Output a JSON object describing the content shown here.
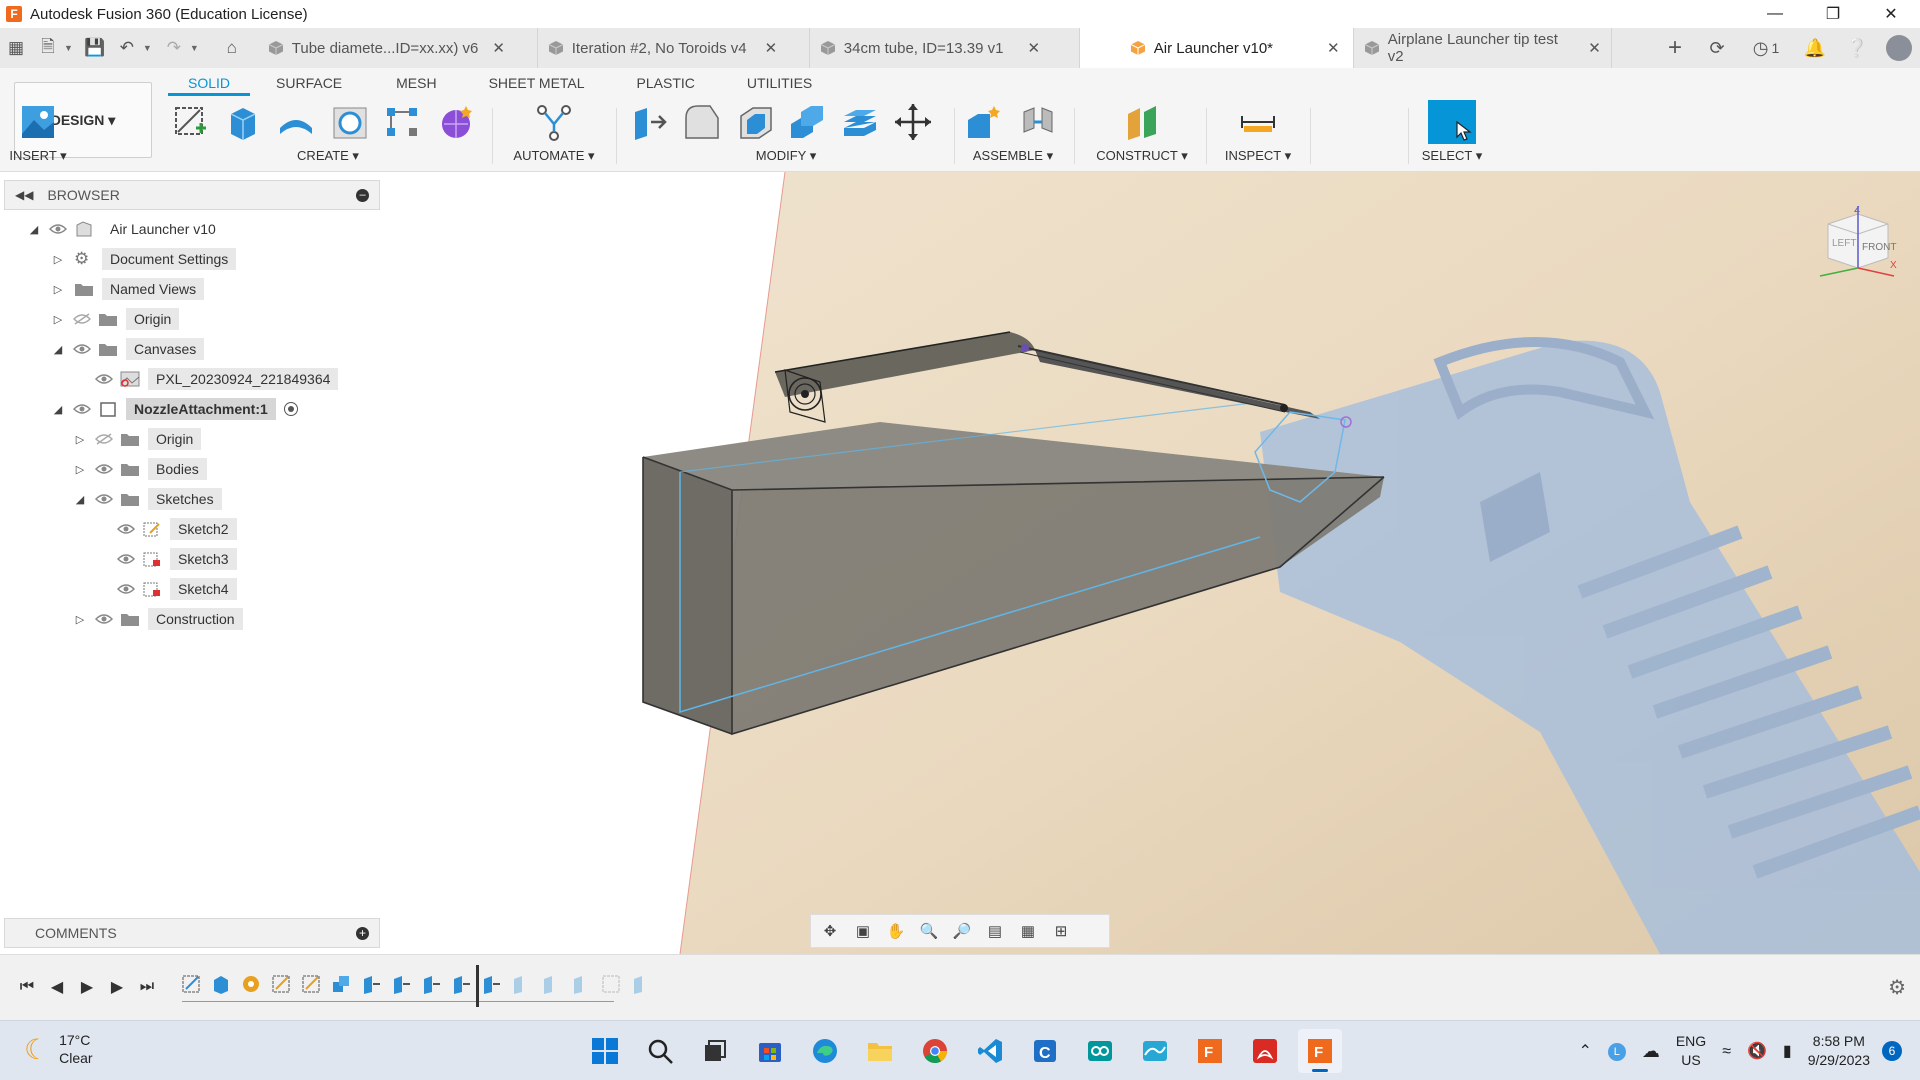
{
  "window": {
    "title": "Autodesk Fusion 360 (Education License)",
    "logo_letter": "F"
  },
  "tabs": [
    {
      "label": "Tube diamete...ID=xx.xx) v6",
      "active": false
    },
    {
      "label": "Iteration #2, No Toroids v4",
      "active": false
    },
    {
      "label": "34cm tube, ID=13.39 v1",
      "active": false
    },
    {
      "label": "Air Launcher v10*",
      "active": true
    },
    {
      "label": "Airplane Launcher tip test v2",
      "active": false
    }
  ],
  "tab_right": {
    "job_count": "1"
  },
  "ribbon": {
    "design_label": "DESIGN ▾",
    "workspace_tabs": [
      "SOLID",
      "SURFACE",
      "MESH",
      "SHEET METAL",
      "PLASTIC",
      "UTILITIES"
    ],
    "groups": {
      "create": "CREATE ▾",
      "automate": "AUTOMATE ▾",
      "modify": "MODIFY ▾",
      "assemble": "ASSEMBLE ▾",
      "construct": "CONSTRUCT ▾",
      "inspect": "INSPECT ▾",
      "insert": "INSERT ▾",
      "select": "SELECT ▾"
    }
  },
  "browser": {
    "title": "BROWSER",
    "items": [
      {
        "label": "Air Launcher v10"
      },
      {
        "label": "Document Settings"
      },
      {
        "label": "Named Views"
      },
      {
        "label": "Origin"
      },
      {
        "label": "Canvases"
      },
      {
        "label": "PXL_20230924_221849364"
      },
      {
        "label": "NozzleAttachment:1"
      },
      {
        "label": "Origin"
      },
      {
        "label": "Bodies"
      },
      {
        "label": "Sketches"
      },
      {
        "label": "Sketch2"
      },
      {
        "label": "Sketch3"
      },
      {
        "label": "Sketch4"
      },
      {
        "label": "Construction"
      }
    ]
  },
  "comments": {
    "title": "COMMENTS"
  },
  "viewcube": {
    "front": "FRONT",
    "left": "LEFT",
    "z": "Z",
    "x": "X"
  },
  "taskbar": {
    "temperature": "17°C",
    "condition": "Clear",
    "language": "ENG",
    "region": "US",
    "time": "8:58 PM",
    "date": "9/29/2023",
    "notifications": "6"
  },
  "colors": {
    "accent": "#0696d7",
    "fusion_orange": "#f06a1d",
    "body_gray": "#777770"
  }
}
